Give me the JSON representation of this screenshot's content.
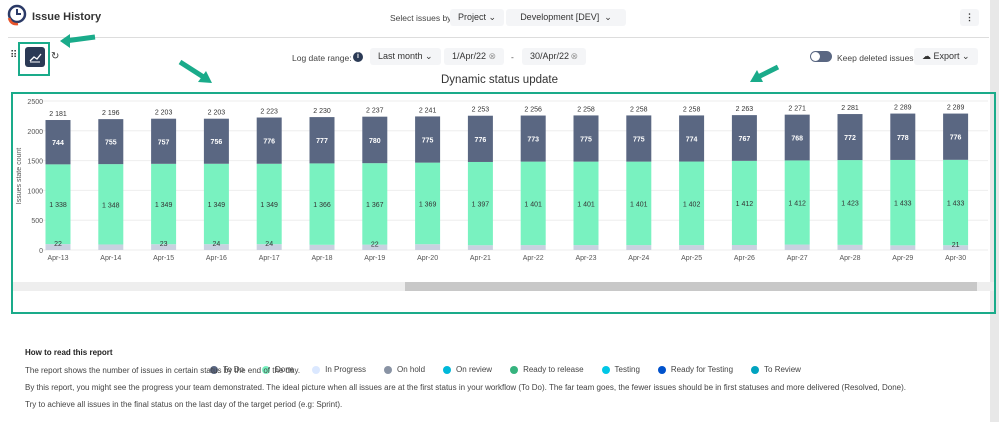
{
  "header": {
    "title": "Issue History",
    "select_label": "Select issues by:",
    "select_type": "Project",
    "select_value": "Development [DEV]",
    "more_icon": "vertical-dots-icon",
    "logo_icon": "clock-history-icon"
  },
  "toolbar": {
    "log_date_label": "Log date range:",
    "range_preset": "Last month",
    "date_from": "1/Apr/22",
    "date_sep": "-",
    "date_to": "30/Apr/22",
    "keep_deleted": "Keep deleted issues",
    "keep_deleted_on": false,
    "export": "Export"
  },
  "colors": {
    "accent": "#1aab8a",
    "todo": "#5a6782",
    "done": "#79f2c0"
  },
  "chart_data": {
    "type": "bar",
    "stacked": true,
    "title": "Dynamic status update",
    "ylabel": "Issues state count",
    "ylim": [
      0,
      2500
    ],
    "yticks": [
      0,
      500,
      1000,
      1500,
      2000,
      2500
    ],
    "grid": true,
    "legend_position": "bottom",
    "categories": [
      "Apr-13",
      "Apr-14",
      "Apr-15",
      "Apr-16",
      "Apr-17",
      "Apr-18",
      "Apr-19",
      "Apr-20",
      "Apr-21",
      "Apr-22",
      "Apr-23",
      "Apr-24",
      "Apr-25",
      "Apr-26",
      "Apr-27",
      "Apr-28",
      "Apr-29",
      "Apr-30"
    ],
    "totals": [
      2181,
      2196,
      2203,
      2203,
      2223,
      2230,
      2237,
      2241,
      2253,
      2256,
      2258,
      2258,
      2258,
      2263,
      2271,
      2281,
      2289,
      2289
    ],
    "series": [
      {
        "name": "To Do",
        "color": "#5a6782",
        "values": [
          744,
          755,
          757,
          756,
          776,
          777,
          780,
          775,
          776,
          773,
          775,
          775,
          774,
          767,
          768,
          772,
          778,
          776
        ]
      },
      {
        "name": "Done",
        "color": "#79f2c0",
        "values": [
          1338,
          1348,
          1349,
          1349,
          1349,
          1366,
          1367,
          1369,
          1397,
          1401,
          1401,
          1401,
          1402,
          1412,
          1412,
          1423,
          1433,
          1433
        ]
      }
    ],
    "other_labels": [
      "22",
      "",
      "23",
      "24",
      "24",
      "",
      "22",
      "",
      "",
      "",
      "",
      "",
      "",
      "",
      "",
      "",
      "",
      "21"
    ],
    "legend": [
      {
        "name": "To Do",
        "color": "#5a6782"
      },
      {
        "name": "Done",
        "color": "#79f2c0"
      },
      {
        "name": "In Progress",
        "color": "#dbe8ff"
      },
      {
        "name": "On hold",
        "color": "#8993a4"
      },
      {
        "name": "On review",
        "color": "#00b8d9"
      },
      {
        "name": "Ready to release",
        "color": "#36b37e"
      },
      {
        "name": "Testing",
        "color": "#00c7e6"
      },
      {
        "name": "Ready for Testing",
        "color": "#0052cc"
      },
      {
        "name": "To Review",
        "color": "#00a3bf"
      }
    ]
  },
  "help": {
    "title": "How to read this report",
    "p1": "The report shows the number of issues in certain status by the end of the day.",
    "p2": "By this report, you might see the progress your team demonstrated. The ideal picture when all issues are at the first status in your workflow (To Do). The far team goes, the fewer issues should be in first statuses and more delivered (Resolved, Done).",
    "p3": "Try to achieve all issues in the final status on the last day of the target period (e.g: Sprint)."
  }
}
